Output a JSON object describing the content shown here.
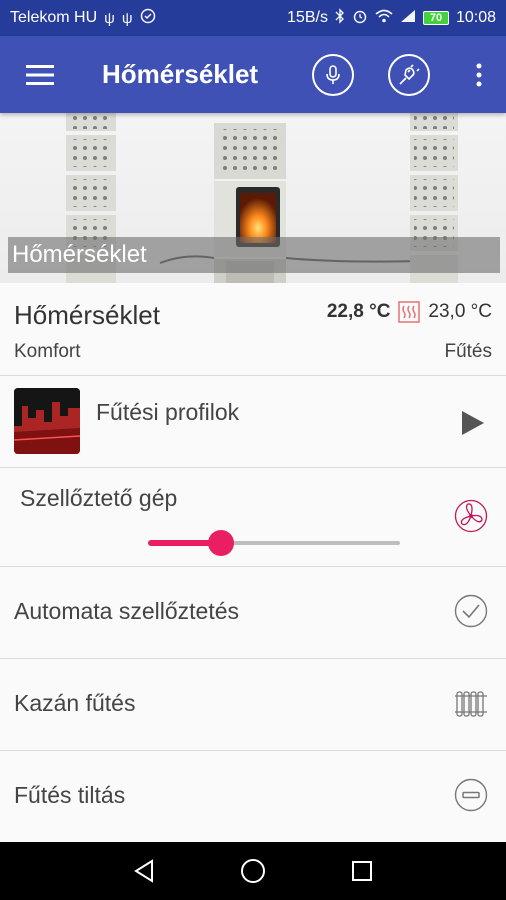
{
  "status_bar": {
    "carrier": "Telekom HU",
    "speed": "15B/s",
    "battery": "70",
    "time": "10:08"
  },
  "app_bar": {
    "title": "Hőmérséklet",
    "icons": [
      "menu-icon",
      "microphone-icon",
      "plug-icon",
      "more-vert-icon"
    ]
  },
  "hero": {
    "caption": "Hőmérséklet"
  },
  "temperature": {
    "title": "Hőmérséklet",
    "mode": "Komfort",
    "current": "22,8 °C",
    "target": "23,0 °C",
    "status": "Fűtés"
  },
  "profiles": {
    "label": "Fűtési profilok"
  },
  "ventilation": {
    "label": "Szellőztető gép",
    "level_percent": 29
  },
  "options": {
    "auto_vent": "Automata szellőztetés",
    "boiler_heating": "Kazán fűtés",
    "heating_block": "Fűtés tiltás"
  },
  "colors": {
    "status_bar": "#263c9a",
    "app_bar": "#3f51b5",
    "accent": "#e91e63",
    "heat_icon": "#e57373"
  }
}
